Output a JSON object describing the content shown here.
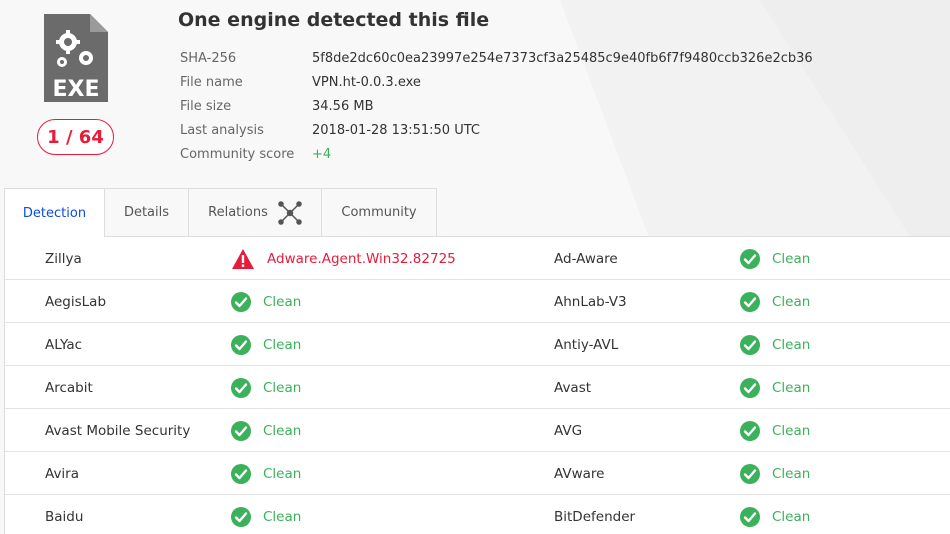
{
  "file": {
    "title": "One engine detected this file",
    "icon_label": "EXE",
    "score": "1 / 64",
    "meta": [
      {
        "label": "SHA-256",
        "value": "5f8de2dc60c0ea23997e254e7373cf3a25485c9e40fb6f7f9480ccb326e2cb36"
      },
      {
        "label": "File name",
        "value": "VPN.ht-0.0.3.exe"
      },
      {
        "label": "File size",
        "value": "34.56 MB"
      },
      {
        "label": "Last analysis",
        "value": "2018-01-28 13:51:50 UTC"
      },
      {
        "label": "Community score",
        "value": "+4"
      }
    ]
  },
  "tabs": [
    {
      "label": "Detection"
    },
    {
      "label": "Details"
    },
    {
      "label": "Relations"
    },
    {
      "label": "Community"
    }
  ],
  "colors": {
    "clean": "#3bb15b",
    "malicious": "#e51d3a",
    "accent": "#0b4dda"
  },
  "detections": [
    {
      "left": {
        "engine": "Zillya",
        "result": "Adware.Agent.Win32.82725",
        "status": "malicious"
      },
      "right": {
        "engine": "Ad-Aware",
        "result": "Clean",
        "status": "clean"
      }
    },
    {
      "left": {
        "engine": "AegisLab",
        "result": "Clean",
        "status": "clean"
      },
      "right": {
        "engine": "AhnLab-V3",
        "result": "Clean",
        "status": "clean"
      }
    },
    {
      "left": {
        "engine": "ALYac",
        "result": "Clean",
        "status": "clean"
      },
      "right": {
        "engine": "Antiy-AVL",
        "result": "Clean",
        "status": "clean"
      }
    },
    {
      "left": {
        "engine": "Arcabit",
        "result": "Clean",
        "status": "clean"
      },
      "right": {
        "engine": "Avast",
        "result": "Clean",
        "status": "clean"
      }
    },
    {
      "left": {
        "engine": "Avast Mobile Security",
        "result": "Clean",
        "status": "clean"
      },
      "right": {
        "engine": "AVG",
        "result": "Clean",
        "status": "clean"
      }
    },
    {
      "left": {
        "engine": "Avira",
        "result": "Clean",
        "status": "clean"
      },
      "right": {
        "engine": "AVware",
        "result": "Clean",
        "status": "clean"
      }
    },
    {
      "left": {
        "engine": "Baidu",
        "result": "Clean",
        "status": "clean"
      },
      "right": {
        "engine": "BitDefender",
        "result": "Clean",
        "status": "clean"
      }
    }
  ]
}
